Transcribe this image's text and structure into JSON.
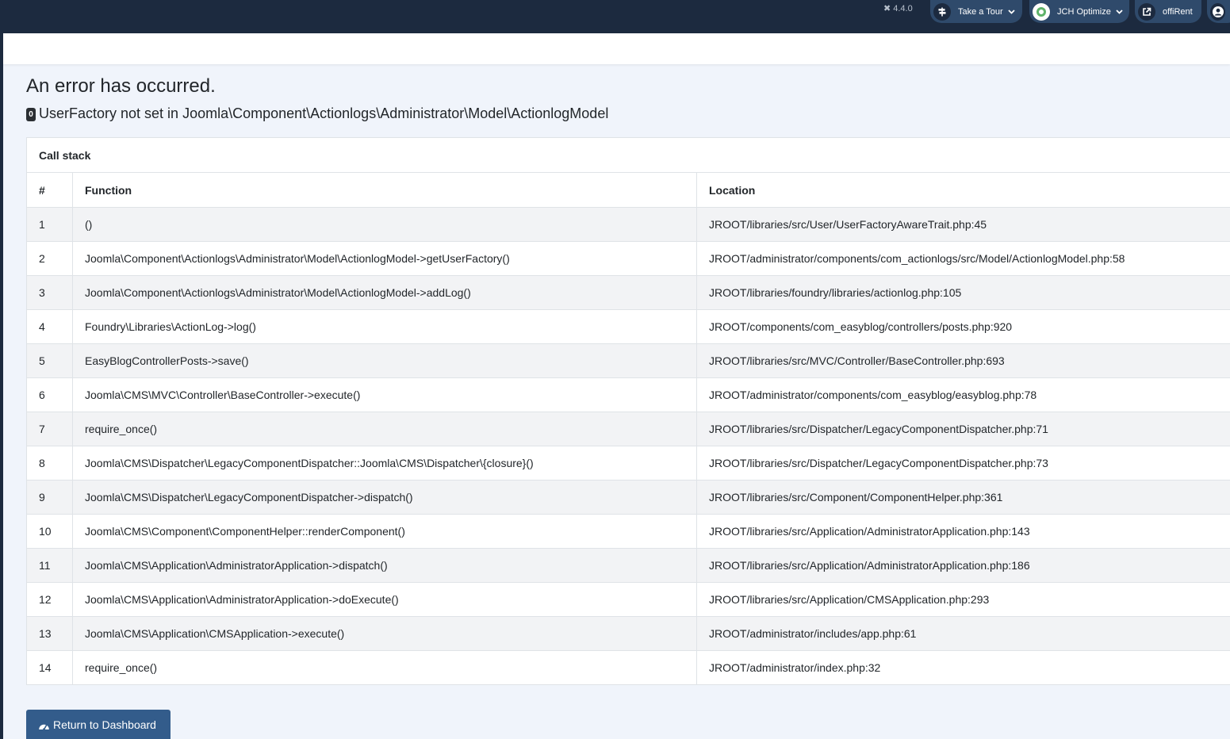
{
  "header": {
    "version": "4.4.0",
    "tour_label": "Take a Tour",
    "jch_label": "JCH Optimize",
    "site_label": "offiRent"
  },
  "main": {
    "title": "An error has occurred.",
    "error_code": "0",
    "error_message": "UserFactory not set in Joomla\\Component\\Actionlogs\\Administrator\\Model\\ActionlogModel"
  },
  "call_stack": {
    "caption": "Call stack",
    "columns": [
      "#",
      "Function",
      "Location"
    ],
    "rows": [
      {
        "num": "1",
        "fn": "()",
        "loc": "JROOT/libraries/src/User/UserFactoryAwareTrait.php:45"
      },
      {
        "num": "2",
        "fn": "Joomla\\Component\\Actionlogs\\Administrator\\Model\\ActionlogModel->getUserFactory()",
        "loc": "JROOT/administrator/components/com_actionlogs/src/Model/ActionlogModel.php:58"
      },
      {
        "num": "3",
        "fn": "Joomla\\Component\\Actionlogs\\Administrator\\Model\\ActionlogModel->addLog()",
        "loc": "JROOT/libraries/foundry/libraries/actionlog.php:105"
      },
      {
        "num": "4",
        "fn": "Foundry\\Libraries\\ActionLog->log()",
        "loc": "JROOT/components/com_easyblog/controllers/posts.php:920"
      },
      {
        "num": "5",
        "fn": "EasyBlogControllerPosts->save()",
        "loc": "JROOT/libraries/src/MVC/Controller/BaseController.php:693"
      },
      {
        "num": "6",
        "fn": "Joomla\\CMS\\MVC\\Controller\\BaseController->execute()",
        "loc": "JROOT/administrator/components/com_easyblog/easyblog.php:78"
      },
      {
        "num": "7",
        "fn": "require_once()",
        "loc": "JROOT/libraries/src/Dispatcher/LegacyComponentDispatcher.php:71"
      },
      {
        "num": "8",
        "fn": "Joomla\\CMS\\Dispatcher\\LegacyComponentDispatcher::Joomla\\CMS\\Dispatcher\\{closure}()",
        "loc": "JROOT/libraries/src/Dispatcher/LegacyComponentDispatcher.php:73"
      },
      {
        "num": "9",
        "fn": "Joomla\\CMS\\Dispatcher\\LegacyComponentDispatcher->dispatch()",
        "loc": "JROOT/libraries/src/Component/ComponentHelper.php:361"
      },
      {
        "num": "10",
        "fn": "Joomla\\CMS\\Component\\ComponentHelper::renderComponent()",
        "loc": "JROOT/libraries/src/Application/AdministratorApplication.php:143"
      },
      {
        "num": "11",
        "fn": "Joomla\\CMS\\Application\\AdministratorApplication->dispatch()",
        "loc": "JROOT/libraries/src/Application/AdministratorApplication.php:186"
      },
      {
        "num": "12",
        "fn": "Joomla\\CMS\\Application\\AdministratorApplication->doExecute()",
        "loc": "JROOT/libraries/src/Application/CMSApplication.php:293"
      },
      {
        "num": "13",
        "fn": "Joomla\\CMS\\Application\\CMSApplication->execute()",
        "loc": "JROOT/administrator/includes/app.php:61"
      },
      {
        "num": "14",
        "fn": "require_once()",
        "loc": "JROOT/administrator/index.php:32"
      }
    ]
  },
  "footer": {
    "return_label": "Return to Dashboard"
  },
  "icons": {
    "version": "joomla-icon",
    "tour": "signpost-icon",
    "jch": "jch-optimize-icon",
    "site": "external-link-icon",
    "user": "user-icon",
    "return": "dashboard-gauge-icon"
  },
  "colors": {
    "header_bg": "#1c2a3f",
    "header_button": "#2f4a6b",
    "primary_button": "#335c8b",
    "page_bg": "#f0f4fb"
  }
}
